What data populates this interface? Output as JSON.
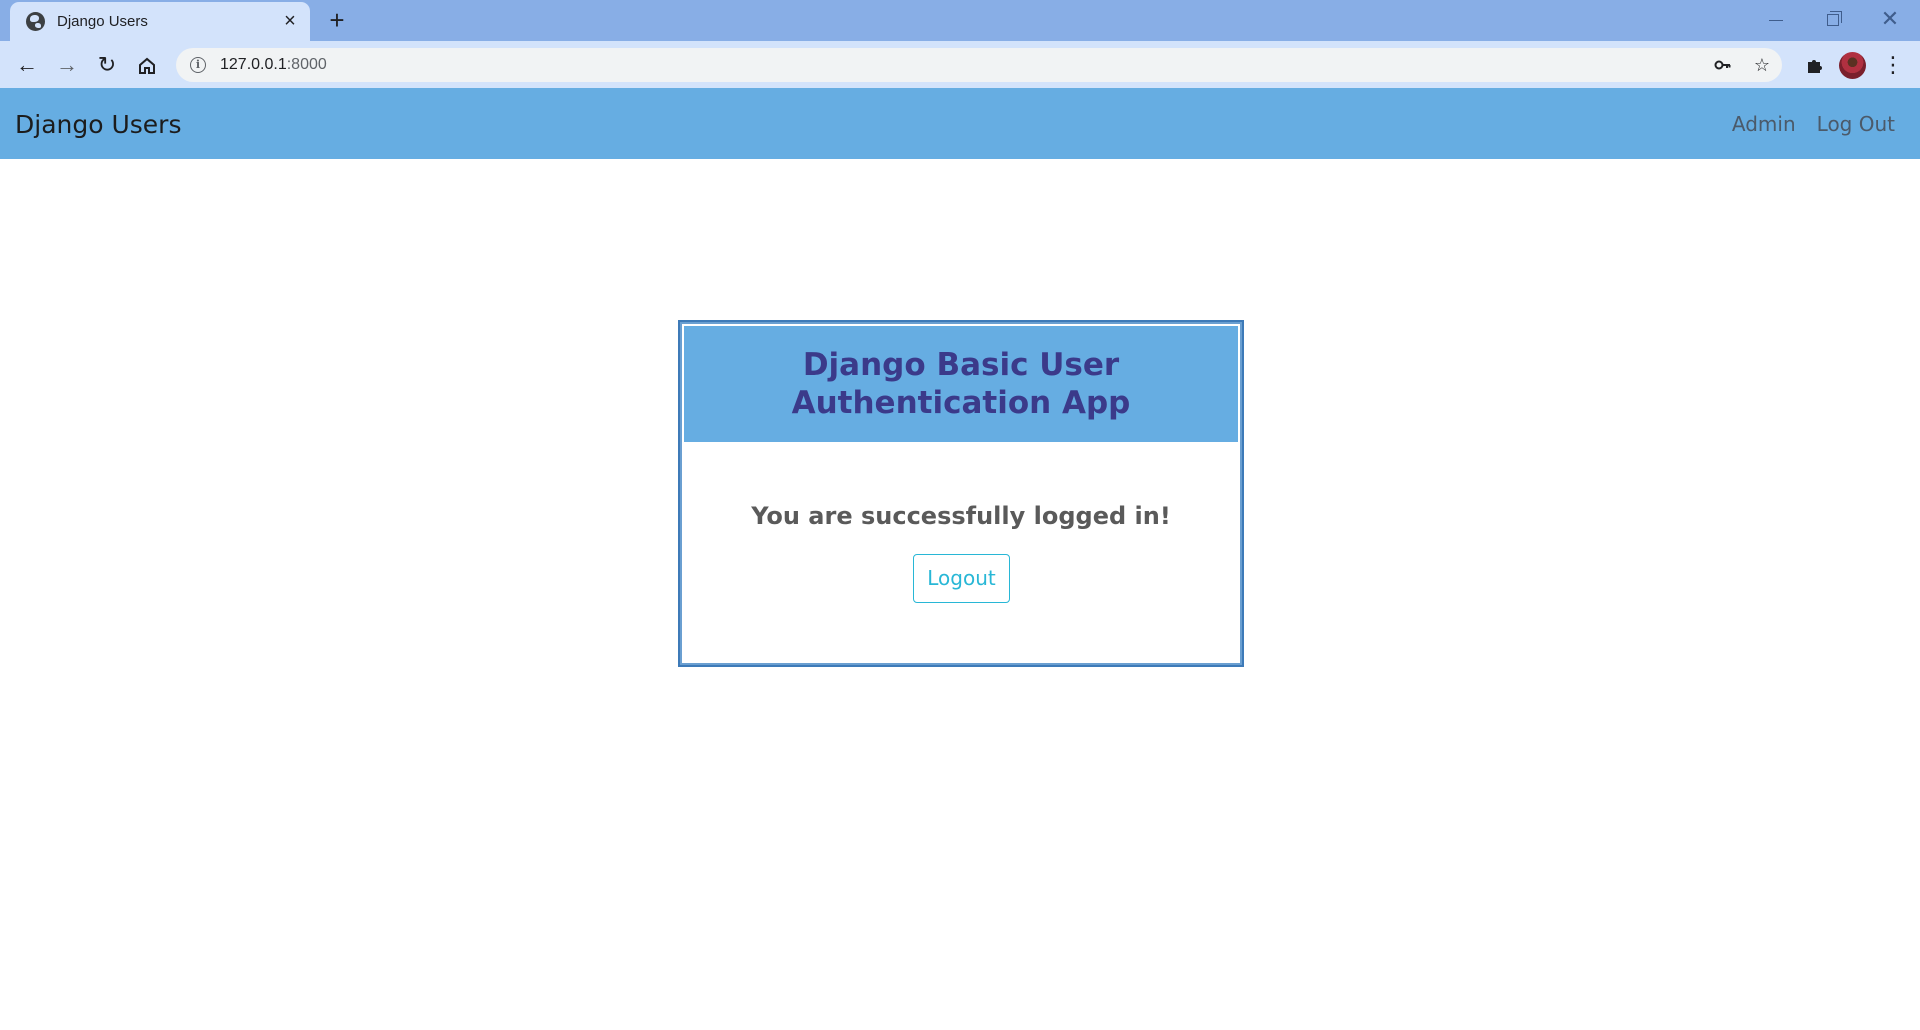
{
  "browser": {
    "tab_title": "Django Users",
    "url_host": "127.0.0.1",
    "url_port": ":8000",
    "icons": {
      "tab_favicon": "globe-icon",
      "tab_close": "close-icon",
      "new_tab": "plus-icon",
      "back": "arrow-left-icon",
      "forward": "arrow-right-icon",
      "reload": "reload-icon",
      "home": "home-icon",
      "site_info": "info-icon",
      "password": "key-icon",
      "bookmark": "star-icon",
      "extensions": "puzzle-icon",
      "menu": "kebab-menu-icon"
    }
  },
  "site_nav": {
    "brand": "Django Users",
    "links": [
      "Admin",
      "Log Out"
    ]
  },
  "card": {
    "title": "Django Basic User Authentication App",
    "message": "You are successfully logged in!",
    "button_label": "Logout"
  },
  "colors": {
    "tabstrip": "#88aee6",
    "toolbar": "#d3e3fb",
    "navbar": "#66ade2",
    "card_border": "#3d7ab8",
    "title_text": "#3b3a8a",
    "button_accent": "#28b7d6"
  }
}
